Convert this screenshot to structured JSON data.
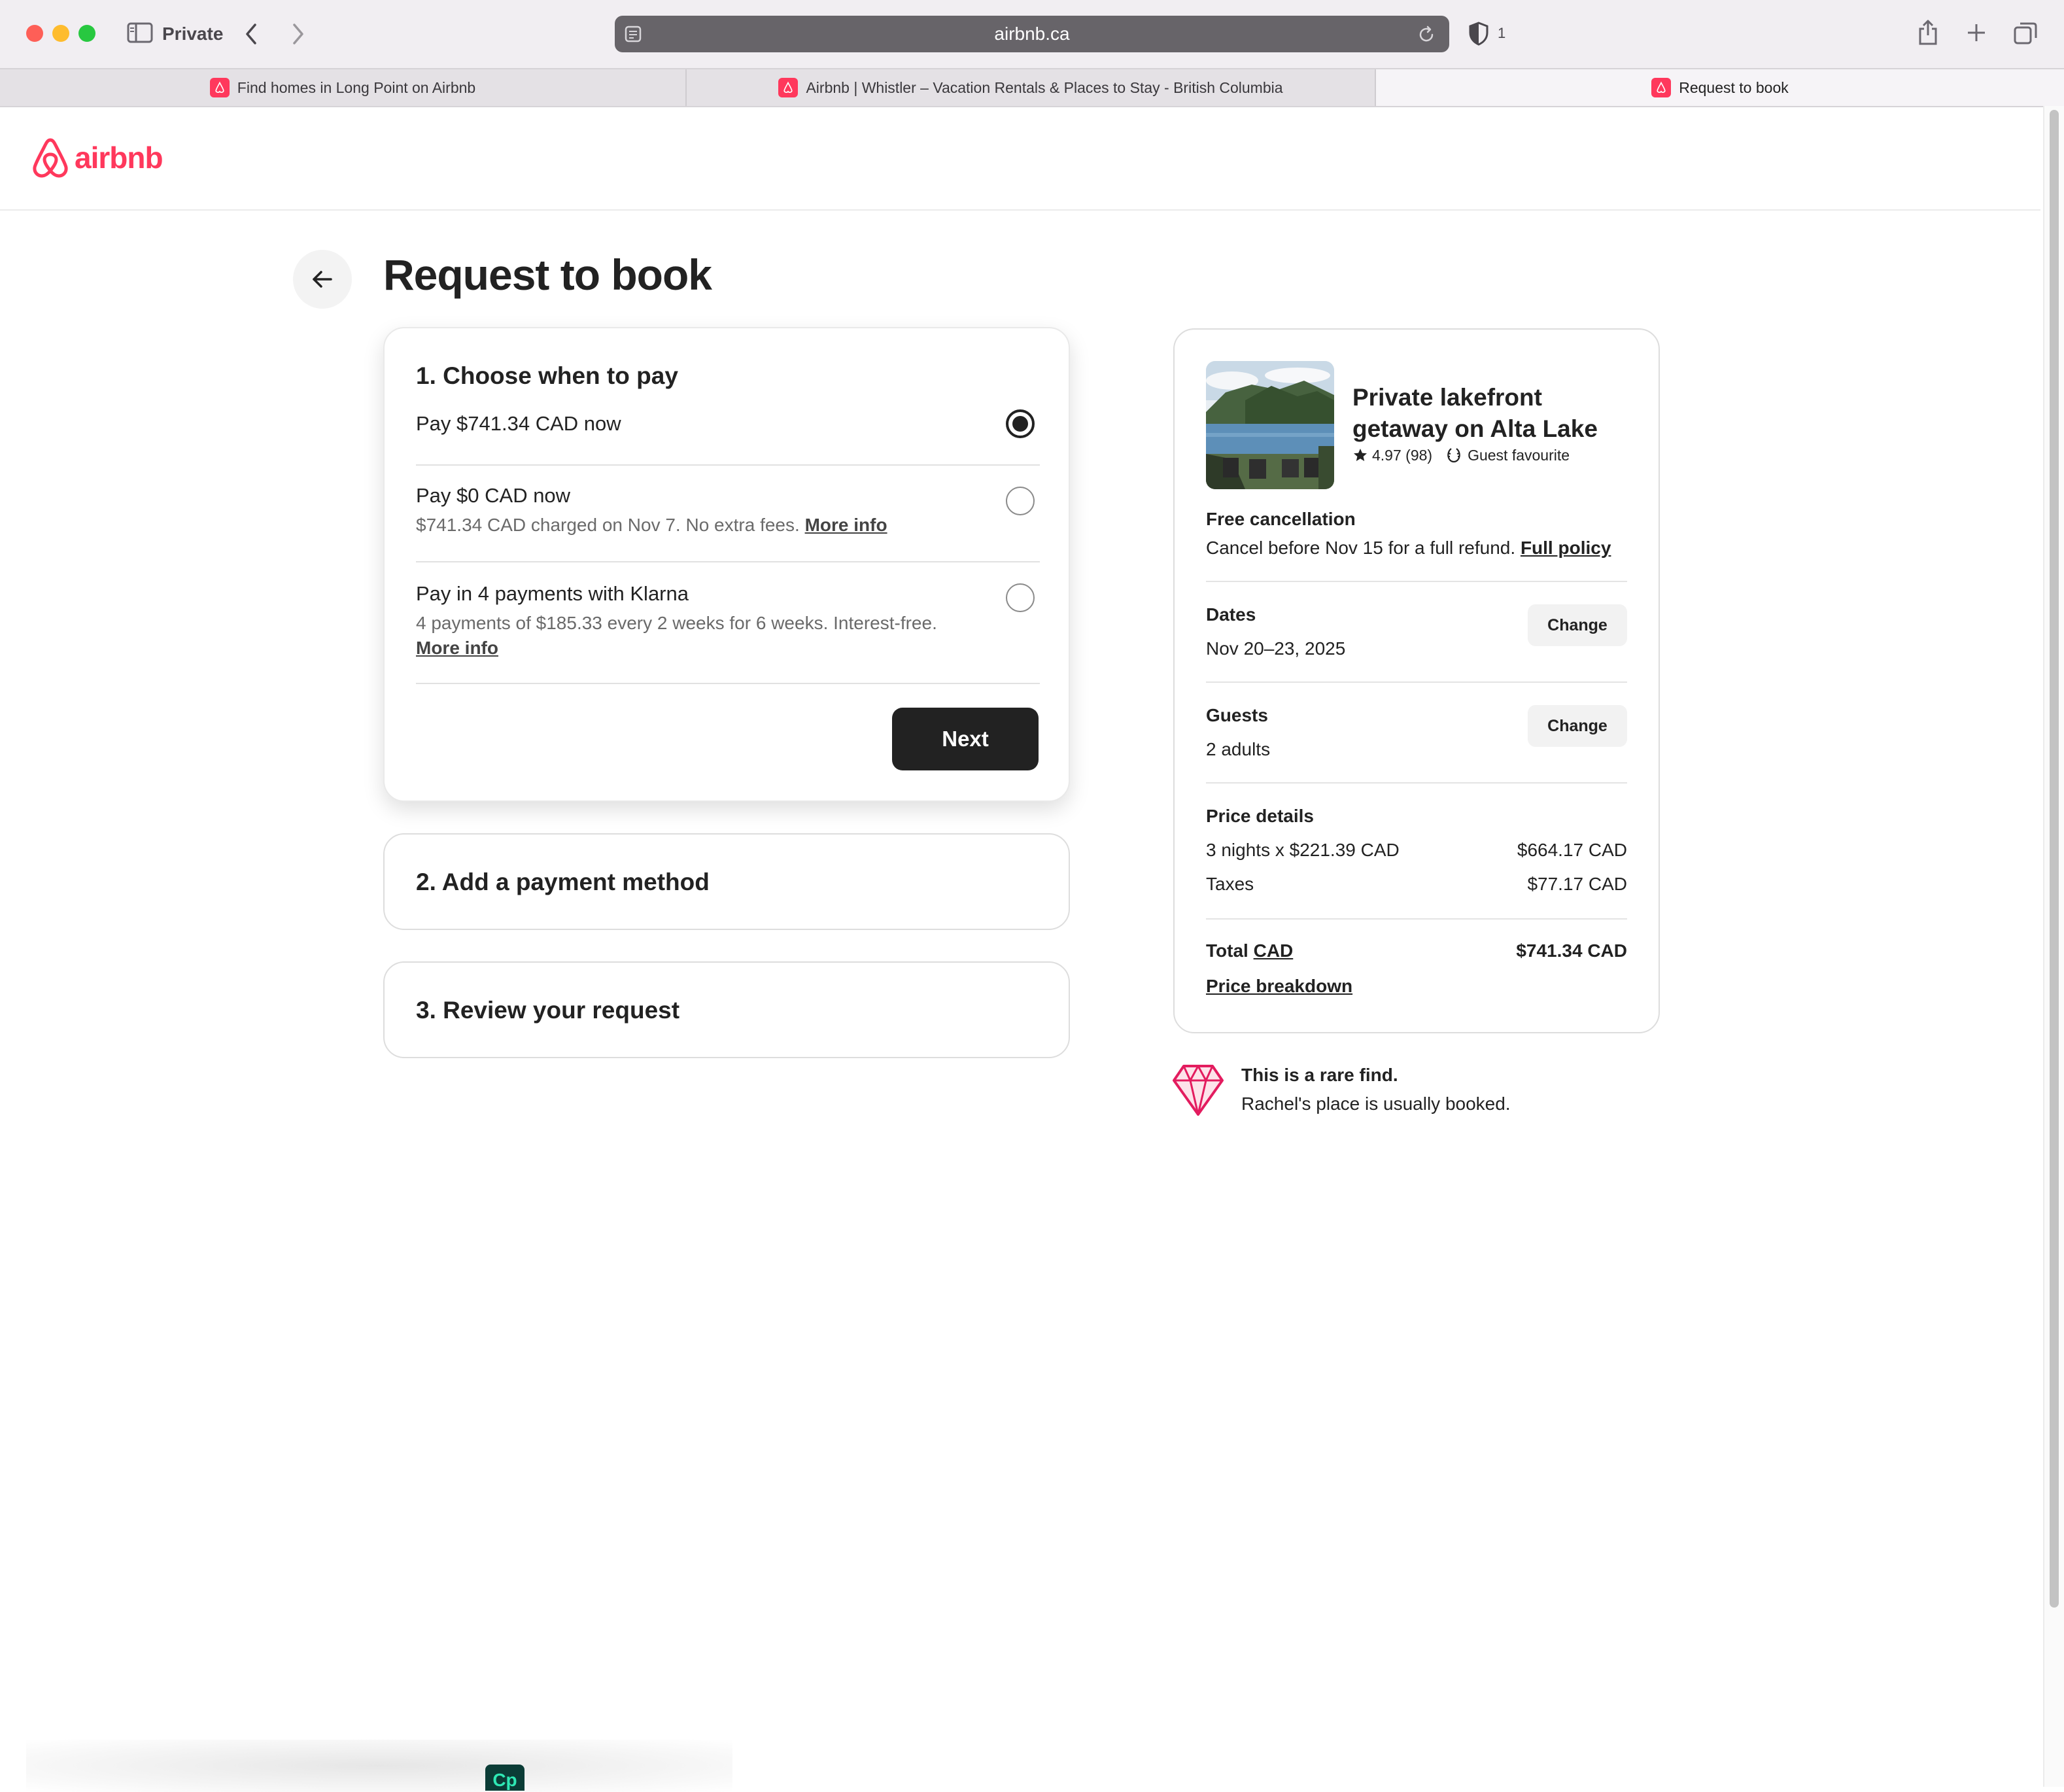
{
  "browser": {
    "private_label": "Private",
    "url": "airbnb.ca",
    "shield_count": "1",
    "tabs": [
      {
        "label": "Find homes in Long Point on Airbnb"
      },
      {
        "label": "Airbnb | Whistler – Vacation Rentals & Places to Stay - British Columbia"
      },
      {
        "label": "Request to book"
      }
    ]
  },
  "header": {
    "logo_text": "airbnb",
    "brand_color": "#ff385c"
  },
  "page": {
    "title": "Request to book"
  },
  "step1": {
    "title": "1. Choose when to pay",
    "options": [
      {
        "main": "Pay $741.34 CAD now",
        "selected": true
      },
      {
        "main": "Pay $0 CAD now",
        "sub": "$741.34 CAD charged on Nov 7. No extra fees.",
        "link": "More info",
        "selected": false
      },
      {
        "main": "Pay in 4 payments with Klarna",
        "sub": "4 payments of $185.33 every 2 weeks for 6 weeks. Interest-free.",
        "link": "More info",
        "selected": false
      }
    ],
    "next_label": "Next"
  },
  "step2": {
    "title": "2. Add a payment method"
  },
  "step3": {
    "title": "3. Review your request"
  },
  "summary": {
    "listing_title": "Private lakefront getaway on Alta Lake",
    "rating": "4.97 (98)",
    "badge": "Guest favourite",
    "cancellation_title": "Free cancellation",
    "cancellation_text": "Cancel before Nov 15 for a full refund.",
    "cancellation_link": "Full policy",
    "dates_label": "Dates",
    "dates_value": "Nov 20–23, 2025",
    "guests_label": "Guests",
    "guests_value": "2 adults",
    "change_label": "Change",
    "price_details_label": "Price details",
    "line_items": [
      {
        "label": "3 nights x $221.39 CAD",
        "amount": "$664.17 CAD"
      },
      {
        "label": "Taxes",
        "amount": "$77.17 CAD"
      }
    ],
    "total_label": "Total",
    "total_currency": "CAD",
    "total_amount": "$741.34 CAD",
    "breakdown_link": "Price breakdown"
  },
  "rare_find": {
    "title": "This is a rare find.",
    "text": "Rachel's place is usually booked."
  },
  "dock": {
    "app_label": "Cp"
  },
  "icons": [
    "sidebar-icon",
    "back-chevron-icon",
    "forward-chevron-icon",
    "reader-icon",
    "reload-icon",
    "shield-icon",
    "share-icon",
    "new-tab-icon",
    "tab-overview-icon",
    "airbnb-logo-icon",
    "back-arrow-icon",
    "star-icon",
    "laurel-icon",
    "diamond-icon"
  ]
}
